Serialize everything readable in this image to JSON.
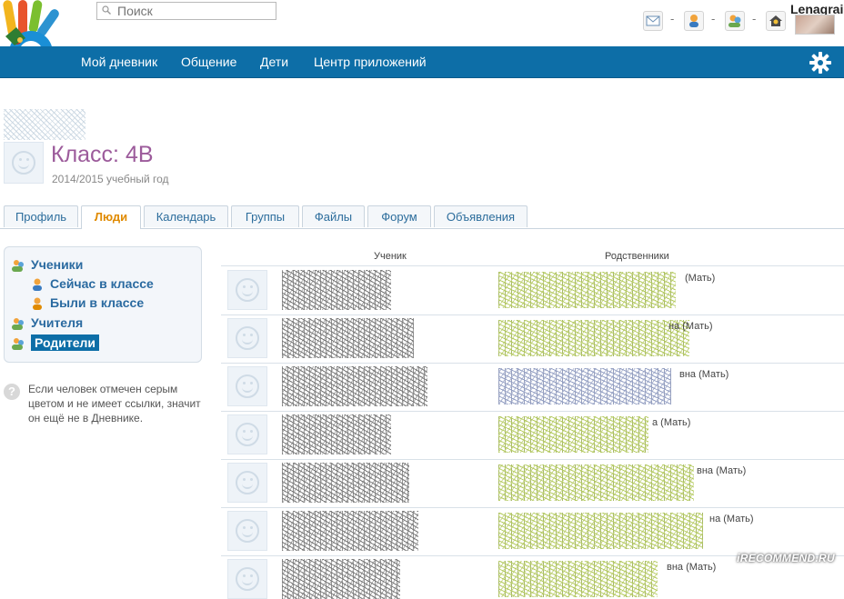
{
  "search": {
    "placeholder": "Поиск"
  },
  "user": {
    "name": "Lenagrai"
  },
  "topbar": {
    "separator": "-"
  },
  "nav": {
    "items": [
      "Мой дневник",
      "Общение",
      "Дети",
      "Центр приложений"
    ]
  },
  "class_header": {
    "title": "Класс: 4В",
    "year": "2014/2015 учебный год"
  },
  "tabs": [
    "Профиль",
    "Люди",
    "Календарь",
    "Группы",
    "Файлы",
    "Форум",
    "Объявления"
  ],
  "active_tab": "Люди",
  "sidebar": {
    "items": [
      {
        "label": "Ученики"
      },
      {
        "label": "Сейчас в классе"
      },
      {
        "label": "Были в классе"
      },
      {
        "label": "Учителя"
      },
      {
        "label": "Родители"
      }
    ],
    "selected": "Родители"
  },
  "help": {
    "text": "Если человек отмечен серым цветом и не имеет ссылки, значит он ещё не в Дневнике."
  },
  "table": {
    "headers": {
      "student": "Ученик",
      "relatives": "Родственники"
    },
    "rows": [
      {
        "relative_suffix": "(Мать)"
      },
      {
        "relative_suffix": "на (Мать)"
      },
      {
        "relative_suffix": "вна (Мать)"
      },
      {
        "relative_suffix": "а (Мать)"
      },
      {
        "relative_suffix": "вна (Мать)"
      },
      {
        "relative_suffix": "на (Мать)"
      },
      {
        "relative_suffix": "вна (Мать)"
      }
    ]
  },
  "watermark": "iRECOMMEND.RU",
  "colors": {
    "nav_bg": "#0d6ea7",
    "title": "#9c5b9b",
    "active_tab": "#e08a00",
    "link": "#2a6aa0"
  }
}
